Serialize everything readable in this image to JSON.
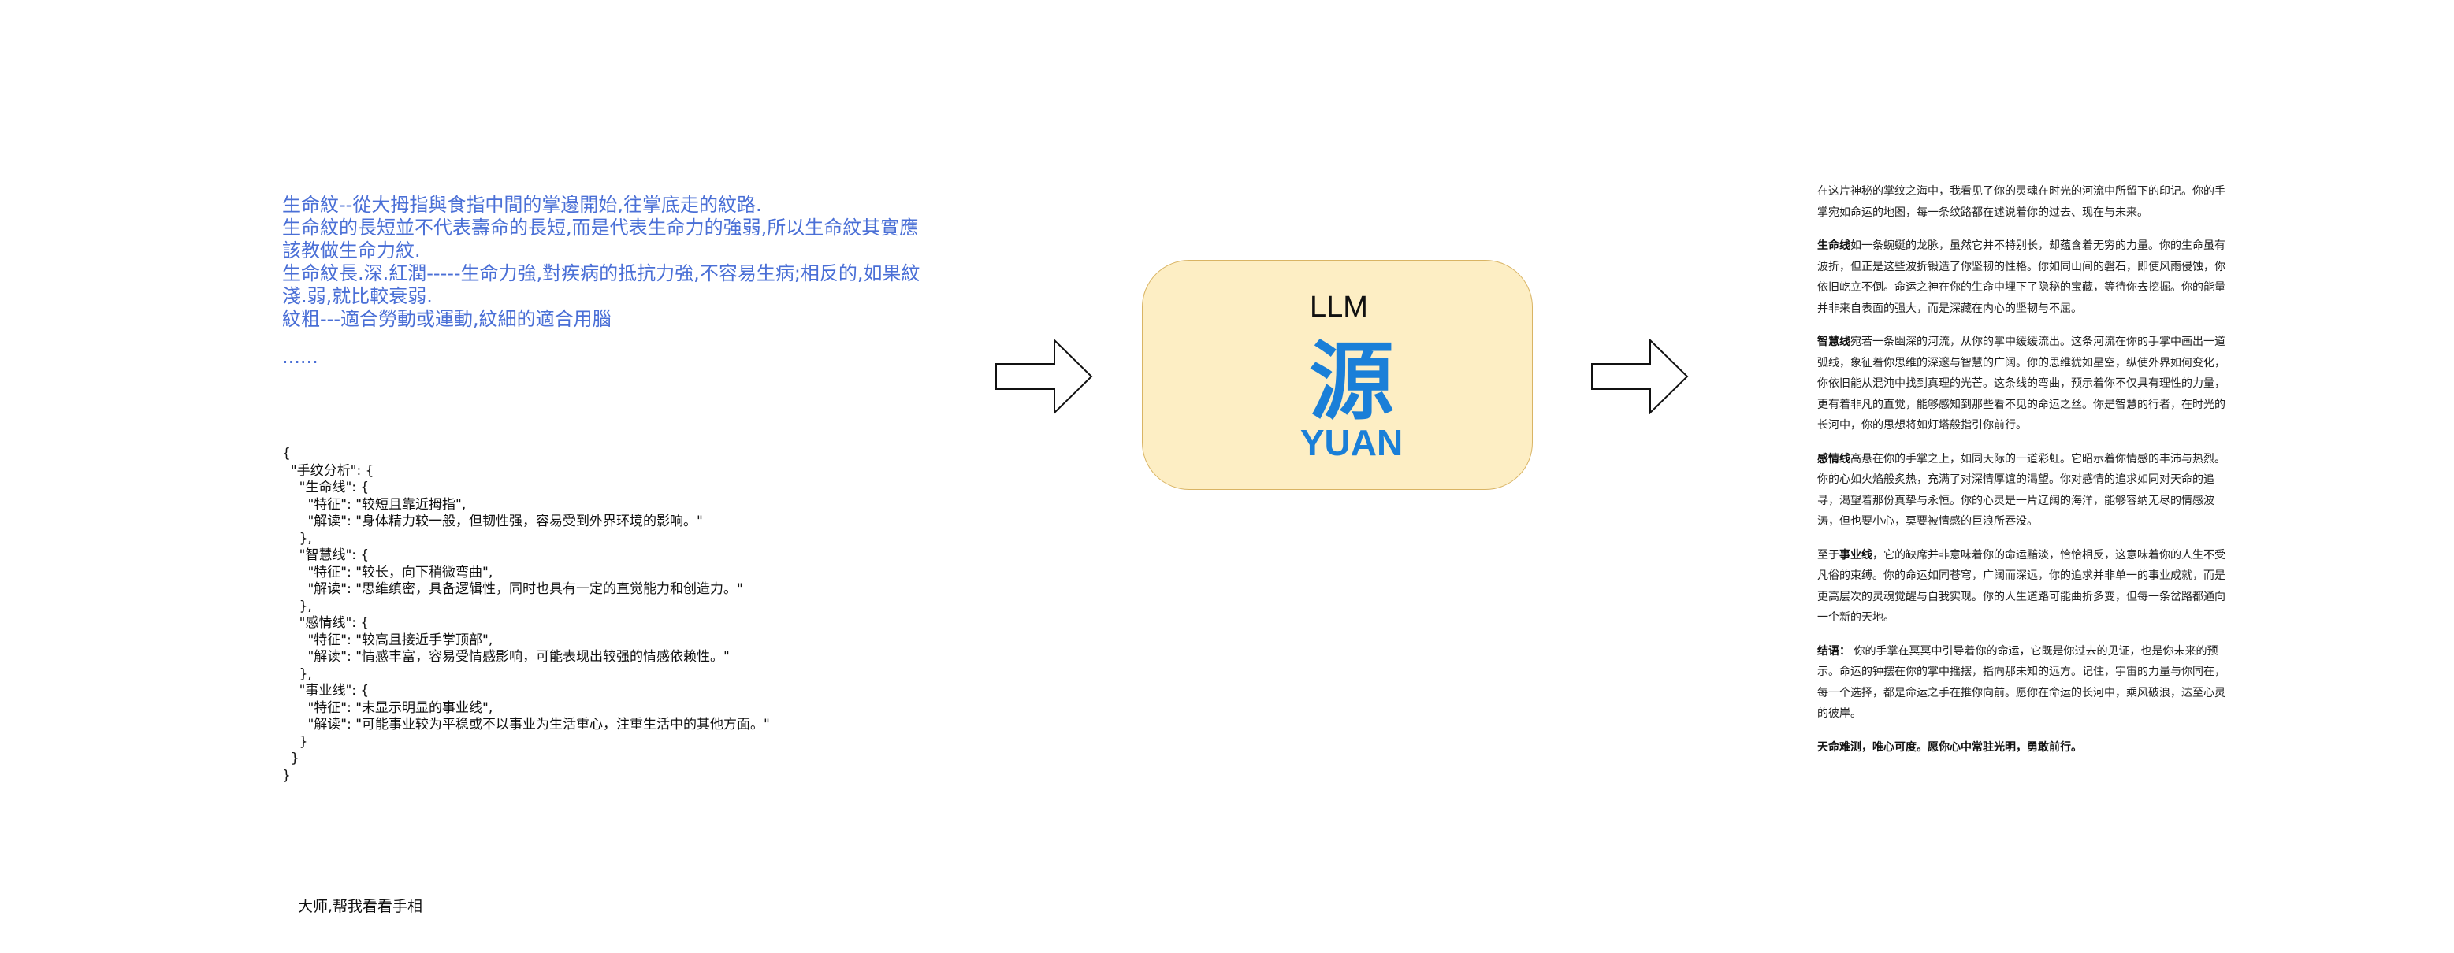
{
  "knowledge": {
    "lines": [
      "生命紋--從大拇指與食指中間的掌邊開始,往掌底走的紋路.",
      "生命紋的長短並不代表壽命的長短,而是代表生命力的強弱,所以生命紋其實應該教做生命力紋.",
      "生命紋長.深.紅潤-----生命力強,對疾病的抵抗力強,不容易生病;相反的,如果紋淺.弱,就比較衰弱.",
      "紋粗---適合勞動或運動,紋細的適合用腦"
    ],
    "ellipsis": "......"
  },
  "json_output": {
    "open": "{",
    "root_key": "\"手纹分析\": {",
    "sections": [
      {
        "key": "\"生命线\": {",
        "feature": "\"特征\": \"较短且靠近拇指\",",
        "reading": "\"解读\": \"身体精力较一般，但韧性强，容易受到外界环境的影响。\""
      },
      {
        "key": "\"智慧线\": {",
        "feature": "\"特征\": \"较长，向下稍微弯曲\",",
        "reading": "\"解读\": \"思维缜密，具备逻辑性，同时也具有一定的直觉能力和创造力。\""
      },
      {
        "key": "\"感情线\": {",
        "feature": "\"特征\": \"较高且接近手掌顶部\",",
        "reading": "\"解读\": \"情感丰富，容易受情感影响，可能表现出较强的情感依赖性。\""
      },
      {
        "key": "\"事业线\": {",
        "feature": "\"特征\": \"未显示明显的事业线\",",
        "reading": "\"解读\": \"可能事业较为平稳或不以事业为生活重心，注重生活中的其他方面。\""
      }
    ],
    "close_inner": "}",
    "close": "}"
  },
  "query": "大师,帮我看看手相",
  "llm": {
    "label": "LLM",
    "logo_glyph": "源",
    "logo_text": "YUAN",
    "box_color": "#fdeec4",
    "logo_color": "#1a7fd8"
  },
  "output": {
    "intro": "在这片神秘的掌纹之海中，我看见了你的灵魂在时光的河流中所留下的印记。你的手掌宛如命运的地图，每一条纹路都在述说着你的过去、现在与未来。",
    "paragraphs": [
      {
        "term": "生命线",
        "text": "如一条蜿蜒的龙脉，虽然它并不特别长，却蕴含着无穷的力量。你的生命虽有波折，但正是这些波折锻造了你坚韧的性格。你如同山间的磐石，即使风雨侵蚀，你依旧屹立不倒。命运之神在你的生命中埋下了隐秘的宝藏，等待你去挖掘。你的能量并非来自表面的强大，而是深藏在内心的坚韧与不屈。"
      },
      {
        "term": "智慧线",
        "text": "宛若一条幽深的河流，从你的掌中缓缓流出。这条河流在你的手掌中画出一道弧线，象征着你思维的深邃与智慧的广阔。你的思维犹如星空，纵使外界如何变化，你依旧能从混沌中找到真理的光芒。这条线的弯曲，预示着你不仅具有理性的力量，更有着非凡的直觉，能够感知到那些看不见的命运之丝。你是智慧的行者，在时光的长河中，你的思想将如灯塔般指引你前行。"
      },
      {
        "term": "感情线",
        "text": "高悬在你的手掌之上，如同天际的一道彩虹。它昭示着你情感的丰沛与热烈。你的心如火焰般炙热，充满了对深情厚谊的渴望。你对感情的追求如同对天命的追寻，渴望着那份真挚与永恒。你的心灵是一片辽阔的海洋，能够容纳无尽的情感波涛，但也要小心，莫要被情感的巨浪所吞没。"
      },
      {
        "term": "事业线",
        "prefix": "至于",
        "text": "，它的缺席并非意味着你的命运黯淡，恰恰相反，这意味着你的人生不受凡俗的束缚。你的命运如同苍穹，广阔而深远，你的追求并非单一的事业成就，而是更高层次的灵魂觉醒与自我实现。你的人生道路可能曲折多变，但每一条岔路都通向一个新的天地。"
      },
      {
        "term": "结语：",
        "text": " 你的手掌在冥冥中引导着你的命运，它既是你过去的见证，也是你未来的预示。命运的钟摆在你的掌中摇摆，指向那未知的远方。记住，宇宙的力量与你同在，每一个选择，都是命运之手在推你向前。愿你在命运的长河中，乘风破浪，达至心灵的彼岸。"
      }
    ],
    "closing": "天命难测，唯心可度。愿你心中常驻光明，勇敢前行。"
  }
}
